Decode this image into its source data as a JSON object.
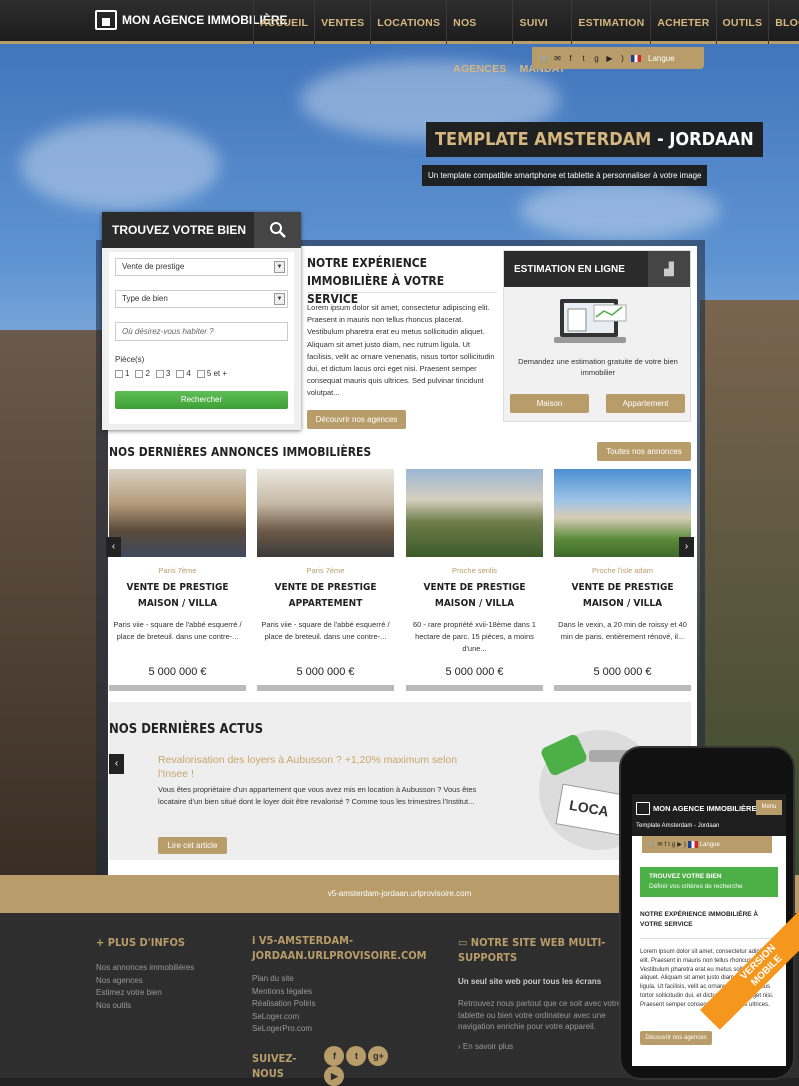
{
  "brand": {
    "name": "MON AGENCE IMMOBILIÈRE"
  },
  "nav": [
    "ACCUEIL",
    "VENTES",
    "LOCATIONS",
    "NOS AGENCES",
    "SUIVI MANDAT",
    "ESTIMATION",
    "ACHETER",
    "OUTILS",
    "BLOG"
  ],
  "social": {
    "icons": [
      "cart-icon",
      "mail-icon",
      "facebook-icon",
      "twitter-icon",
      "googleplus-icon",
      "youtube-icon",
      "rss-icon"
    ],
    "lang": "Langue"
  },
  "hero": {
    "title_main": "TEMPLATE AMSTERDAM",
    "title_sep": " - ",
    "title_accent": "JORDAAN",
    "subtitle": "Un template compatible smartphone et tablette à personnaliser à votre image"
  },
  "search": {
    "title": "TROUVEZ VOTRE BIEN",
    "select1": "Vente de prestige",
    "select2": "Type de bien",
    "placeholder": "Où désirez-vous habiter ?",
    "pieces_label": "Pièce(s)",
    "pieces": [
      "1",
      "2",
      "3",
      "4",
      "5 et +"
    ],
    "button": "Rechercher"
  },
  "experience": {
    "title": "NOTRE EXPÉRIENCE IMMOBILIÈRE À VOTRE SERVICE",
    "text": "Lorem ipsum dolor sit amet, consectetur adipiscing elit. Praesent in mauris non tellus rhoncus placerat. Vestibulum pharetra erat eu metus sollicitudin aliquet. Aliquam sit amet justo diam, nec rutrum ligula. Ut facilisis, velit ac ornare venenatis, nisus tortor sollicitudin dui, et dictum lacus orci eget nisi. Praesent semper consequat mauris quis ultrices. Sed pulvinar tincidunt volutpat...",
    "button": "Découvrir nos agences"
  },
  "estimation": {
    "title": "ESTIMATION EN LIGNE",
    "text": "Demandez une estimation gratuite de votre bien immobilier",
    "btn1": "Maison",
    "btn2": "Appartement"
  },
  "annonces": {
    "title": "NOS DERNIÈRES ANNONCES IMMOBILIÈRES",
    "all_button": "Toutes nos annonces",
    "items": [
      {
        "loc": "Paris 7ème",
        "title1": "VENTE DE PRESTIGE",
        "title2": "MAISON / VILLA",
        "desc": "Paris viie - square de l'abbé esquerré / place de breteuil. dans une contre-...",
        "price": "5 000 000 €"
      },
      {
        "loc": "Paris 7ème",
        "title1": "VENTE DE PRESTIGE",
        "title2": "APPARTEMENT",
        "desc": "Paris viie - square de l'abbé esquerré / place de breteuil. dans une contre-...",
        "price": "5 000 000 €"
      },
      {
        "loc": "Proche senlis",
        "title1": "VENTE DE PRESTIGE",
        "title2": "MAISON / VILLA",
        "desc": "60 - rare propriété xvii-18ème dans 1 hectare de parc. 15 pièces, a moins d'une...",
        "price": "5 000 000 €"
      },
      {
        "loc": "Proche l'isle adam",
        "title1": "VENTE DE PRESTIGE",
        "title2": "MAISON / VILLA",
        "desc": "Dans le vexin, a 20 min de roissy et 40 min de paris. entièrement rénové, il...",
        "price": "5 000 000 €"
      }
    ]
  },
  "actus": {
    "title": "NOS DERNIÈRES ACTUS",
    "headline": "Revalorisation des loyers à Aubusson ? +1,20% maximum selon l'Insee !",
    "text": "Vous êtes propriétaire d'un appartement que vous avez mis en location à Aubusson ? Vous êtes locataire d'un bien situé dont le loyer doit être revalorisé ? Comme tous les trimestres l'Institut...",
    "button": "Lire cet article"
  },
  "url_strip": "v5-amsterdam-jordaan.urlprovisoire.com",
  "footer": {
    "col1": {
      "title": "PLUS D'INFOS",
      "links": [
        "Nos annonces immobilières",
        "Nos agences",
        "Estimez votre bien",
        "Nos outils"
      ]
    },
    "col2": {
      "title": "V5-AMSTERDAM-JORDAAN.URLPROVISOIRE.COM",
      "links": [
        "Plan du site",
        "Mentions légales",
        "Réalisation Poliris",
        "SeLoger.com",
        "SeLogerPro.com"
      ],
      "follow": "SUIVEZ-NOUS",
      "follow_icons": [
        "f",
        "t",
        "g+",
        "▶"
      ]
    },
    "col3": {
      "title": "NOTRE SITE WEB MULTI-SUPPORTS",
      "sub": "Un seul site web pour tous les écrans",
      "text": "Retrouvez nous partout que ce soit avec votre tablette ou bien votre ordinateur avec une navigation enrichie pour votre appareil.",
      "more": "En savoir plus"
    }
  },
  "mobile": {
    "brand": "MON AGENCE IMMOBILIÈRE",
    "menu": "Menu",
    "sub": "Template Amsterdam - Jordaan",
    "lang": "Langue",
    "search_title": "TROUVEZ VOTRE BIEN",
    "search_sub": "Définir vos critères de recherche",
    "exp_title": "NOTRE EXPÉRIENCE IMMOBILIÈRE À VOTRE SERVICE",
    "exp_text": "Lorem ipsum dolor sit amet, consectetur adipiscing elit. Praesent in mauris non tellus rhoncus placerat. Vestibulum pharetra erat eu metus sollicitudin aliquet. Aliquam sit amet justo diam, nec rutrum ligula. Ut facilisis, velit ac ornare venenatis, nisus tortor sollicitudin dui, et dictum lacus orci eget nisi. Praesent semper consequat mauris quis ultrices.",
    "button": "Découvrir nos agences",
    "ribbon1": "VERSION",
    "ribbon2": "MOBILE"
  },
  "colors": {
    "gold": "#b89c6a",
    "dark": "#2b2b2b",
    "green": "#4db046",
    "orange": "#f5961d"
  }
}
